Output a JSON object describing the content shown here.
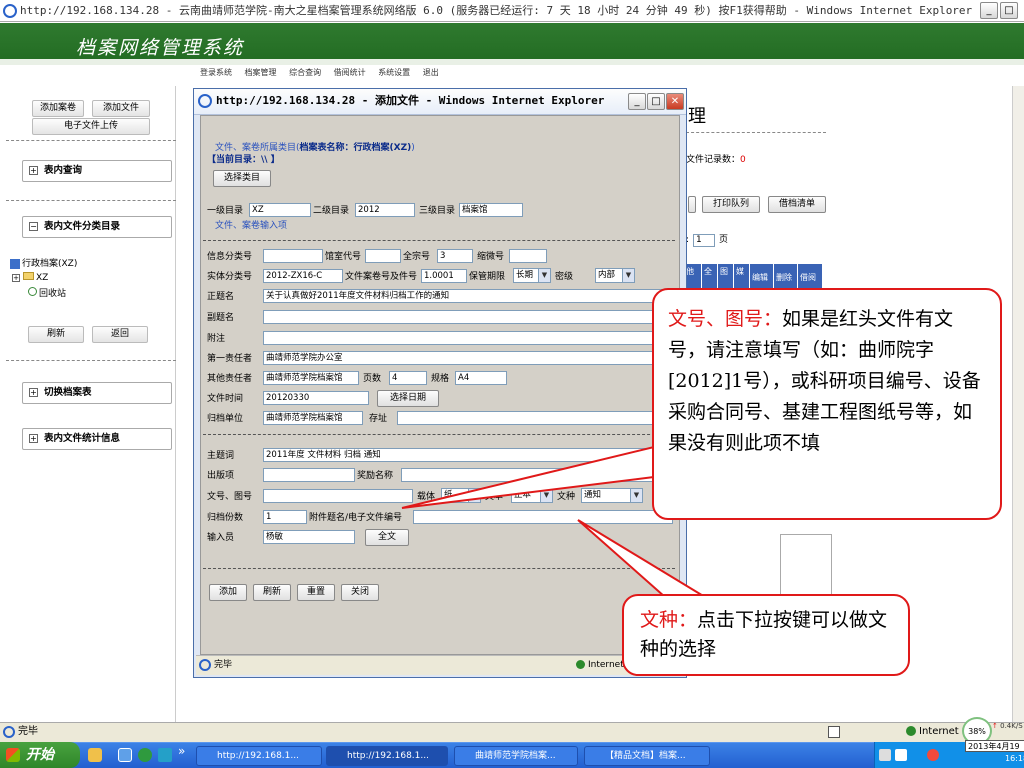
{
  "outer_window": {
    "title": "http://192.168.134.28 - 云南曲靖师范学院-南大之星档案管理系统网络版 6.0 (服务器已经运行: 7 天 18 小时 24 分钟 49 秒) 按F1获得帮助 - Windows Internet Explorer"
  },
  "app": {
    "title": "档案网络管理系统",
    "menu": [
      "登录系统",
      "档案管理",
      "综合查询",
      "借阅统计",
      "系统设置",
      "退出"
    ]
  },
  "sidebar": {
    "add_volume": "添加案卷",
    "add_file": "添加文件",
    "e_upload": "电子文件上传",
    "table_query": "表内查询",
    "table_catalog": "表内文件分类目录",
    "tree_root": "行政档案(XZ)",
    "tree_child": "XZ",
    "tree_recycle": "回收站",
    "refresh": "刷新",
    "back": "返回",
    "switch_table": "切换档案表",
    "table_stats": "表内文件统计信息"
  },
  "main_partial": {
    "heading": "理",
    "file_count": "文件记录数：",
    "file_count_value": "0",
    "print_queue": "打印队列",
    "borrow_list": "借档清单",
    "page_prefix": ":",
    "page_value": "1",
    "page_suffix": "页",
    "column_headers": [
      "他",
      "全",
      "图",
      "媒",
      "编辑",
      "删除",
      "借阅"
    ]
  },
  "popup": {
    "title": "http://192.168.134.28 - 添加文件 - Windows Internet Explorer",
    "category_hint": "文件、案卷所属类目(",
    "table_name_label": "档案表名称：行政档案(XZ)",
    "category_hint_end": ")",
    "current_dir": "【当前目录：\\\\ 】",
    "select_category": "选择类目",
    "level1_label": "一级目录",
    "level1_value": "XZ",
    "level2_label": "二级目录",
    "level2_value": "2012",
    "level3_label": "三级目录",
    "level3_value": "档案馆",
    "input_section": "文件、案卷输入项",
    "info_class_label": "信息分类号",
    "room_code_label": "馆室代号",
    "fonds_label": "全宗号",
    "fonds_value": "3",
    "microfilm_label": "缩微号",
    "entity_class_label": "实体分类号",
    "entity_class_value": "2012-ZX16-C",
    "volume_no_label": "文件案卷号及件号",
    "volume_no_value": "1.0001",
    "retention_label": "保管期限",
    "retention_value": "长期",
    "secret_label": "密级",
    "secret_value": "内部",
    "title_label": "正题名",
    "title_value": "关于认真做好2011年度文件材料归档工作的通知",
    "subtitle_label": "副题名",
    "note_label": "附注",
    "first_resp_label": "第一责任者",
    "first_resp_value": "曲靖师范学院办公室",
    "other_resp_label": "其他责任者",
    "other_resp_value": "曲靖师范学院档案馆",
    "pages_label": "页数",
    "pages_value": "4",
    "spec_label": "规格",
    "spec_value": "A4",
    "file_time_label": "文件时间",
    "file_time_value": "20120330",
    "choose_date": "选择日期",
    "archive_unit_label": "归档单位",
    "archive_unit_value": "曲靖师范学院档案馆",
    "location_label": "存址",
    "subject_label": "主题词",
    "subject_value": "2011年度  文件材料  归档  通知",
    "publish_label": "出版项",
    "award_label": "奖励名称",
    "doc_no_label": "文号、图号",
    "carrier_label": "载体",
    "carrier_value": "纸",
    "text_label": "文本",
    "text_value": "正本",
    "doc_type_label": "文种",
    "doc_type_value": "通知",
    "copies_label": "归档份数",
    "copies_value": "1",
    "attachment_label": "附件题名/电子文件编号",
    "operator_label": "输入员",
    "operator_value": "杨敏",
    "fulltext": "全文",
    "add": "添加",
    "refresh": "刷新",
    "reset": "重置",
    "close": "关闭",
    "status_done": "完毕",
    "status_zone": "Internet"
  },
  "callouts": {
    "doc_no_title": "文号、图号：",
    "doc_no_body": "如果是红头文件有文号，请注意填写（如：曲师院字[2012]1号），或科研项目编号、设备采购合同号、基建工程图纸号等，如果没有则此项不填",
    "doc_type_title": "文种：",
    "doc_type_body": "点击下拉按键可以做文种的选择"
  },
  "statusbar": {
    "text": "完毕",
    "zone": "Internet",
    "zoom": "38%",
    "speed": "0.4K/S"
  },
  "taskbar": {
    "start": "开始",
    "overflow": "»",
    "buttons": [
      "http://192.168.1...",
      "http://192.168.1...",
      "曲靖师范学院档案...",
      "【精品文档】档案..."
    ],
    "date": "2013年4月19",
    "time": "16:18"
  },
  "colors": {
    "banner_green": "#2a7a2a",
    "callout_red": "#e01919",
    "link_blue": "#2a52be",
    "taskbar_blue": "#245edb"
  }
}
